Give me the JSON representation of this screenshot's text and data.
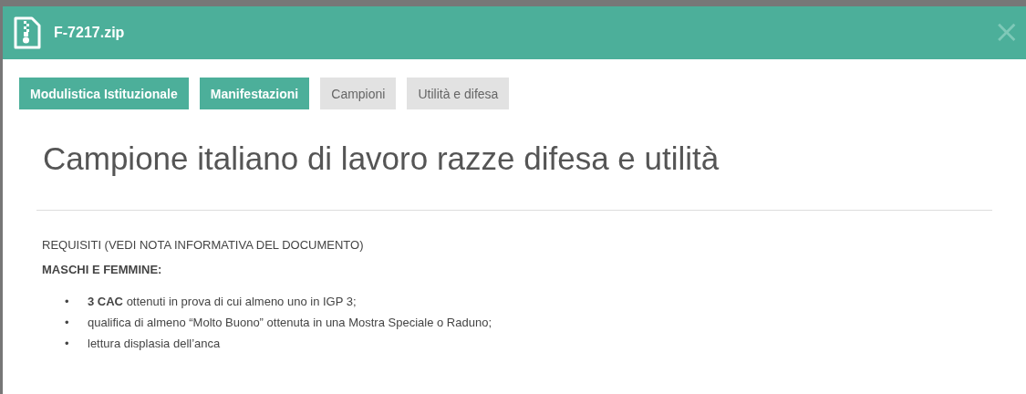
{
  "window": {
    "title": "F-7217.zip",
    "close": "×"
  },
  "tabs": [
    {
      "label": "Modulistica Istituzionale",
      "selected": true
    },
    {
      "label": "Manifestazioni",
      "selected": true
    },
    {
      "label": "Campioni",
      "selected": false
    },
    {
      "label": "Utilità e difesa",
      "selected": false
    }
  ],
  "heading": "Campione italiano di lavoro razze difesa e utilità",
  "requirements": "REQUISITI (VEDI NOTA INFORMATIVA DEL DOCUMENTO)",
  "subheading": "MASCHI E FEMMINE:",
  "items": [
    {
      "bullet": "•",
      "text": "**3 CAC** ottenuti in prova di cui almeno uno in IGP 3;"
    },
    {
      "bullet": "•",
      "text": "qualifica di almeno “Molto Buono” ottenuta in una Mostra Speciale o Raduno;"
    },
    {
      "bullet": "•",
      "text": "lettura displasia dell’anca"
    }
  ]
}
